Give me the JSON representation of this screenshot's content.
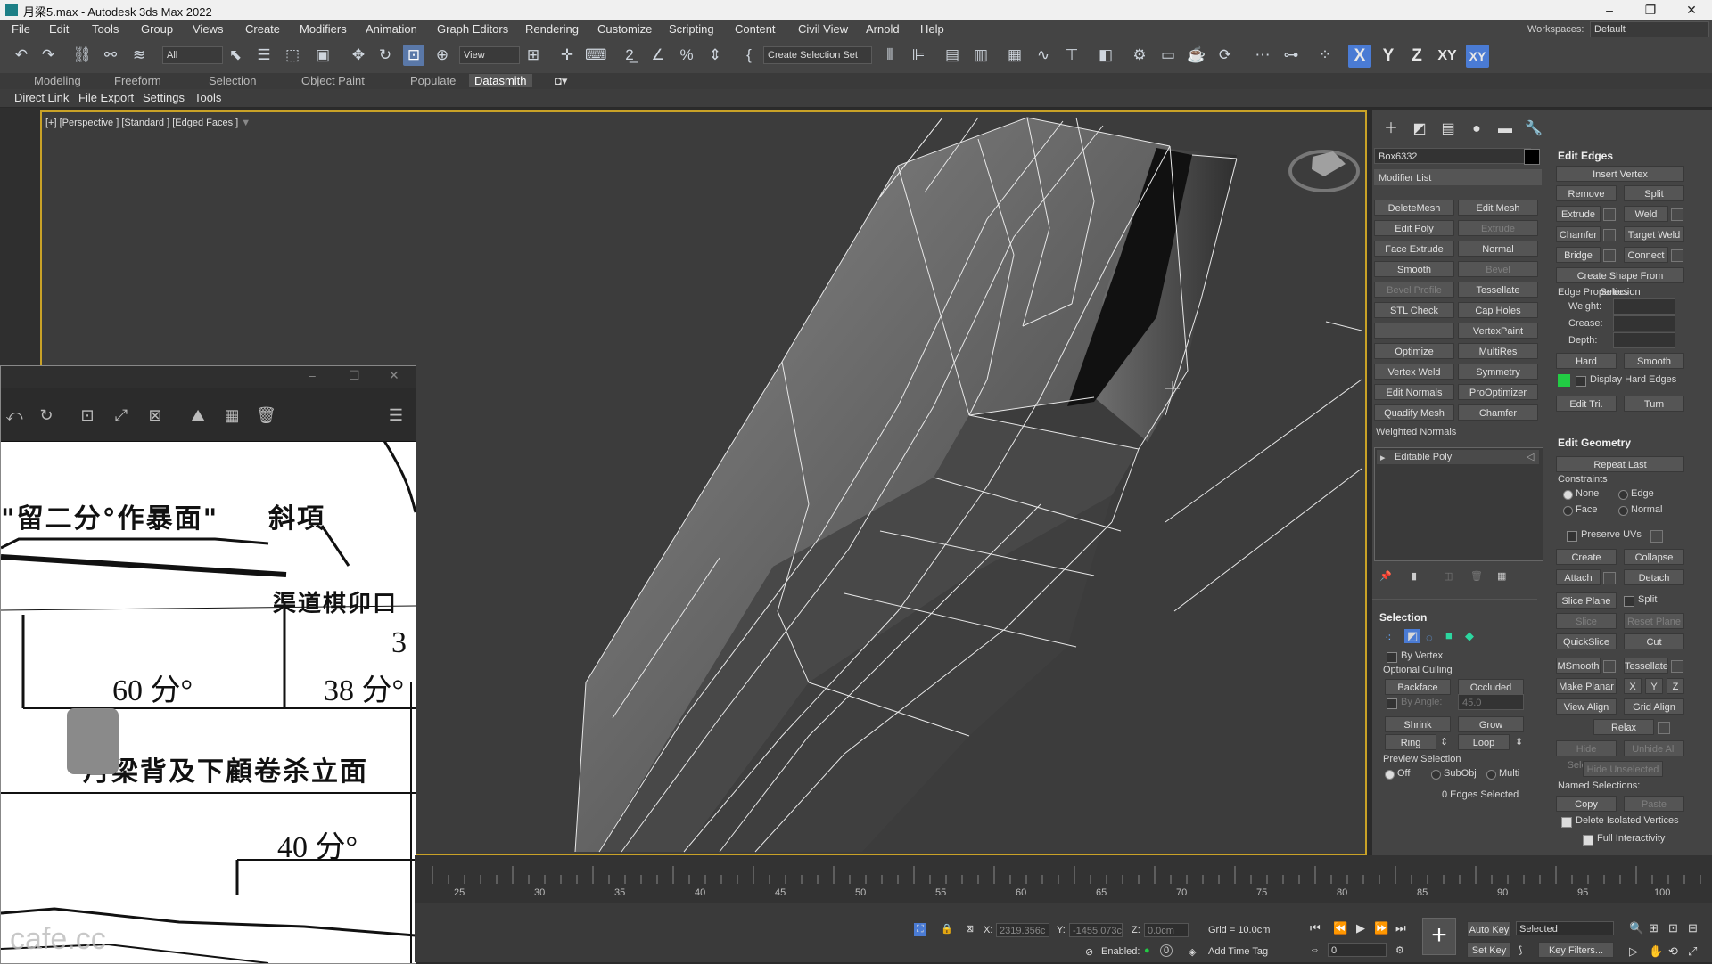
{
  "window": {
    "title": "月梁5.max - Autodesk 3ds Max 2022",
    "minimize": "–",
    "restore": "❐",
    "close": "✕"
  },
  "menu": [
    "File",
    "Edit",
    "Tools",
    "Group",
    "Views",
    "Create",
    "Modifiers",
    "Animation",
    "Graph Editors",
    "Rendering",
    "Customize",
    "Scripting",
    "Content",
    "Civil View",
    "Arnold",
    "Help"
  ],
  "workspace": {
    "label": "Workspaces:",
    "value": "Default"
  },
  "toolbar": {
    "selection_filter": "All",
    "ref_coord": "View",
    "named_selection": "Create Selection Set",
    "axes": [
      "X",
      "Y",
      "Z",
      "XY",
      "XY"
    ]
  },
  "ribbon_tabs": [
    "Modeling",
    "Freeform",
    "Selection",
    "Object Paint",
    "Populate",
    "Datasmith"
  ],
  "sub_toolbar": [
    "Direct Link",
    "File Export",
    "Settings",
    "Tools"
  ],
  "viewport": {
    "label_plus": "[+]",
    "label_view": "[Perspective ]",
    "label_shading": "[Standard ]",
    "label_mode": "[Edged Faces ]"
  },
  "image_viewer": {
    "texts": [
      "\"留二分°作暴面\"",
      "斜項",
      "渠道棋卯口",
      "60 分°",
      "38 分°",
      "3",
      "月梁背及下顧卷杀立面",
      "40 分°"
    ],
    "watermark": "cafe.cc"
  },
  "command_panel": {
    "object_name": "Box6332",
    "modifier_list": "Modifier List",
    "modifier_buttons": [
      [
        "DeleteMesh",
        "Edit Mesh"
      ],
      [
        "Edit Poly",
        "Extrude"
      ],
      [
        "Face Extrude",
        "Normal"
      ],
      [
        "Smooth",
        "Bevel"
      ],
      [
        "Bevel Profile",
        "Tessellate"
      ],
      [
        "STL Check",
        "Cap Holes"
      ],
      [
        "",
        "VertexPaint"
      ],
      [
        "Optimize",
        "MultiRes"
      ],
      [
        "Vertex Weld",
        "Symmetry"
      ],
      [
        "Edit Normals",
        "ProOptimizer"
      ],
      [
        "Quadify Mesh",
        "Chamfer"
      ]
    ],
    "weighted_normals": "Weighted Normals",
    "stack_item": "Editable Poly",
    "selection": {
      "header": "Selection",
      "by_vertex": "By Vertex",
      "optional_culling": "Optional Culling",
      "backface": "Backface",
      "occluded": "Occluded",
      "by_angle": "By Angle:",
      "by_angle_value": "45.0",
      "shrink": "Shrink",
      "grow": "Grow",
      "ring": "Ring",
      "loop": "Loop",
      "preview_selection": "Preview Selection",
      "off": "Off",
      "subobj": "SubObj",
      "multi": "Multi",
      "status": "0 Edges Selected"
    },
    "edit_edges": {
      "header": "Edit Edges",
      "insert_vertex": "Insert Vertex",
      "remove": "Remove",
      "split": "Split",
      "extrude": "Extrude",
      "weld": "Weld",
      "chamfer": "Chamfer",
      "target_weld": "Target Weld",
      "bridge": "Bridge",
      "connect": "Connect",
      "create_shape": "Create Shape From Selection",
      "edge_properties": "Edge Properties",
      "weight": "Weight:",
      "crease": "Crease:",
      "depth": "Depth:",
      "hard": "Hard",
      "smooth": "Smooth",
      "display_hard_edges": "Display Hard Edges",
      "edit_tri": "Edit Tri.",
      "turn": "Turn"
    },
    "edit_geometry": {
      "header": "Edit Geometry",
      "repeat_last": "Repeat Last",
      "constraints": "Constraints",
      "none": "None",
      "edge": "Edge",
      "face": "Face",
      "normal": "Normal",
      "preserve_uvs": "Preserve UVs",
      "create": "Create",
      "collapse": "Collapse",
      "attach": "Attach",
      "detach": "Detach",
      "slice_plane": "Slice Plane",
      "split": "Split",
      "slice": "Slice",
      "reset_plane": "Reset Plane",
      "quickslice": "QuickSlice",
      "cut": "Cut",
      "msmooth": "MSmooth",
      "tessellate": "Tessellate",
      "make_planar": "Make Planar",
      "x": "X",
      "y": "Y",
      "z": "Z",
      "view_align": "View Align",
      "grid_align": "Grid Align",
      "relax": "Relax",
      "hide_selected": "Hide Selected",
      "unhide_all": "Unhide All",
      "hide_unselected": "Hide Unselected",
      "named_selections": "Named Selections:",
      "copy": "Copy",
      "paste": "Paste",
      "delete_isolated": "Delete Isolated Vertices",
      "full_interactivity": "Full Interactivity"
    }
  },
  "timeline": {
    "ticks": [
      "25",
      "30",
      "35",
      "40",
      "45",
      "50",
      "55",
      "60",
      "65",
      "70",
      "75",
      "80",
      "85",
      "90",
      "95",
      "100"
    ]
  },
  "statusbar": {
    "x_label": "X:",
    "x_value": "2319.356c",
    "y_label": "Y:",
    "y_value": "-1455.073c",
    "z_label": "Z:",
    "z_value": "0.0cm",
    "grid": "Grid = 10.0cm",
    "enabled": "Enabled:",
    "add_time_tag": "Add Time Tag",
    "auto_key": "Auto Key",
    "set_key": "Set Key",
    "selected": "Selected",
    "key_filters": "Key Filters...",
    "frame": "0"
  },
  "colors": {
    "viewport_border": "#c9a227",
    "active_axis": "#4a7bd4",
    "hard_edge_swatch": "#22cc44"
  }
}
